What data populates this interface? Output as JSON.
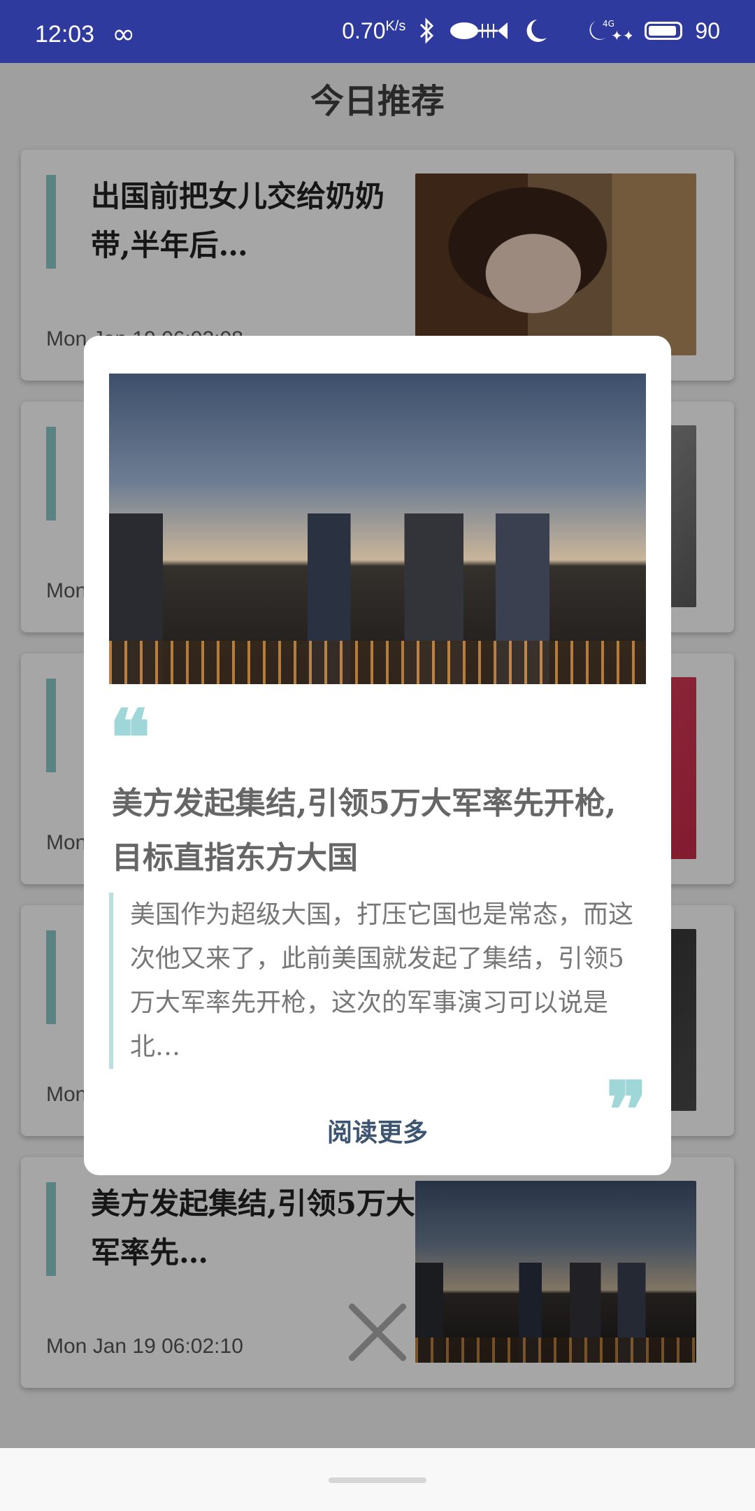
{
  "status_bar": {
    "time": "12:03",
    "infinity_icon": "∞",
    "net_speed": "0.70",
    "net_unit": "K/s",
    "battery": "90"
  },
  "header": {
    "title": "今日推荐"
  },
  "cards": [
    {
      "title": "出国前把女儿交给奶奶带,半年后…",
      "date": "Mon Jan 19 06:02:08 …"
    },
    {
      "title": "",
      "date": "Mon"
    },
    {
      "title": "",
      "date": "Mon"
    },
    {
      "title": "",
      "date": "Mon"
    },
    {
      "title": "美方发起集结,引领5万大军率先…",
      "date": "Mon Jan 19 06:02:10"
    }
  ],
  "popup": {
    "quote_open": "❝",
    "headline": "美方发起集结,引领5万大军率先开枪,目标直指东方大国",
    "summary": "美国作为超级大国，打压它国也是常态，而这次他又来了，此前美国就发起了集结，引领5万大军率先开枪，这次的军事演习可以说是北…",
    "quote_close": "❞",
    "read_more": "阅读更多"
  },
  "icons": {
    "bluetooth": "bluetooth-icon",
    "fish": "fish-icon",
    "moon": "moon-icon",
    "signal": "signal-4g-icon",
    "battery": "battery-icon",
    "close": "close-icon"
  },
  "colors": {
    "status_bar": "#2f3a9e",
    "accent_bar": "#8ec9ca",
    "quote": "#9fd6d8",
    "read_more": "#3d5570"
  }
}
